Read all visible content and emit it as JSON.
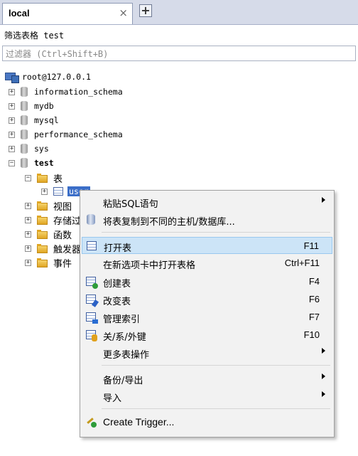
{
  "tabs": {
    "active_label": "local",
    "close_glyph": "×",
    "add_glyph": "+"
  },
  "filter": {
    "title": "筛选表格 test",
    "placeholder": "过滤器 (Ctrl+Shift+B)"
  },
  "tree": {
    "root": "root@127.0.0.1",
    "databases": [
      {
        "name": "information_schema",
        "expander": "+"
      },
      {
        "name": "mydb",
        "expander": "+"
      },
      {
        "name": "mysql",
        "expander": "+"
      },
      {
        "name": "performance_schema",
        "expander": "+"
      },
      {
        "name": "sys",
        "expander": "+"
      },
      {
        "name": "test",
        "expander": "−"
      }
    ],
    "test_children": {
      "tables_label": "表",
      "tables_expander": "−",
      "selected_table": "user",
      "selected_table_expander": "+",
      "folders": [
        {
          "label": "视图",
          "expander": "+"
        },
        {
          "label": "存储过",
          "expander": "+"
        },
        {
          "label": "函数",
          "expander": "+"
        },
        {
          "label": "触发器",
          "expander": "+"
        },
        {
          "label": "事件",
          "expander": "+"
        }
      ]
    }
  },
  "context_menu": {
    "items": [
      {
        "label": "粘贴SQL语句",
        "shortcut": "",
        "submenu": true,
        "icon": ""
      },
      {
        "label": "将表复制到不同的主机/数据库...",
        "shortcut": "",
        "submenu": false,
        "icon": "database-copy-icon"
      },
      {
        "label": "打开表",
        "shortcut": "F11",
        "submenu": false,
        "icon": "table-icon",
        "highlighted": true
      },
      {
        "label": "在新选项卡中打开表格",
        "shortcut": "Ctrl+F11",
        "submenu": false,
        "icon": ""
      },
      {
        "label": "创建表",
        "shortcut": "F4",
        "submenu": false,
        "icon": "table-add-icon"
      },
      {
        "label": "改变表",
        "shortcut": "F6",
        "submenu": false,
        "icon": "table-edit-icon"
      },
      {
        "label": "管理索引",
        "shortcut": "F7",
        "submenu": false,
        "icon": "index-icon"
      },
      {
        "label": "关/系/外键",
        "shortcut": "F10",
        "submenu": false,
        "icon": "key-icon"
      },
      {
        "label": "更多表操作",
        "shortcut": "",
        "submenu": true,
        "icon": ""
      },
      {
        "label": "备份/导出",
        "shortcut": "",
        "submenu": true,
        "icon": ""
      },
      {
        "label": "导入",
        "shortcut": "",
        "submenu": true,
        "icon": ""
      },
      {
        "label": "Create Trigger...",
        "shortcut": "",
        "submenu": false,
        "icon": "trigger-icon"
      }
    ]
  },
  "colors": {
    "highlight_bg": "#cce4f7",
    "highlight_border": "#99c8ef",
    "selection_bg": "#3b6ec8",
    "tabbar_bg": "#d6dbe9"
  }
}
